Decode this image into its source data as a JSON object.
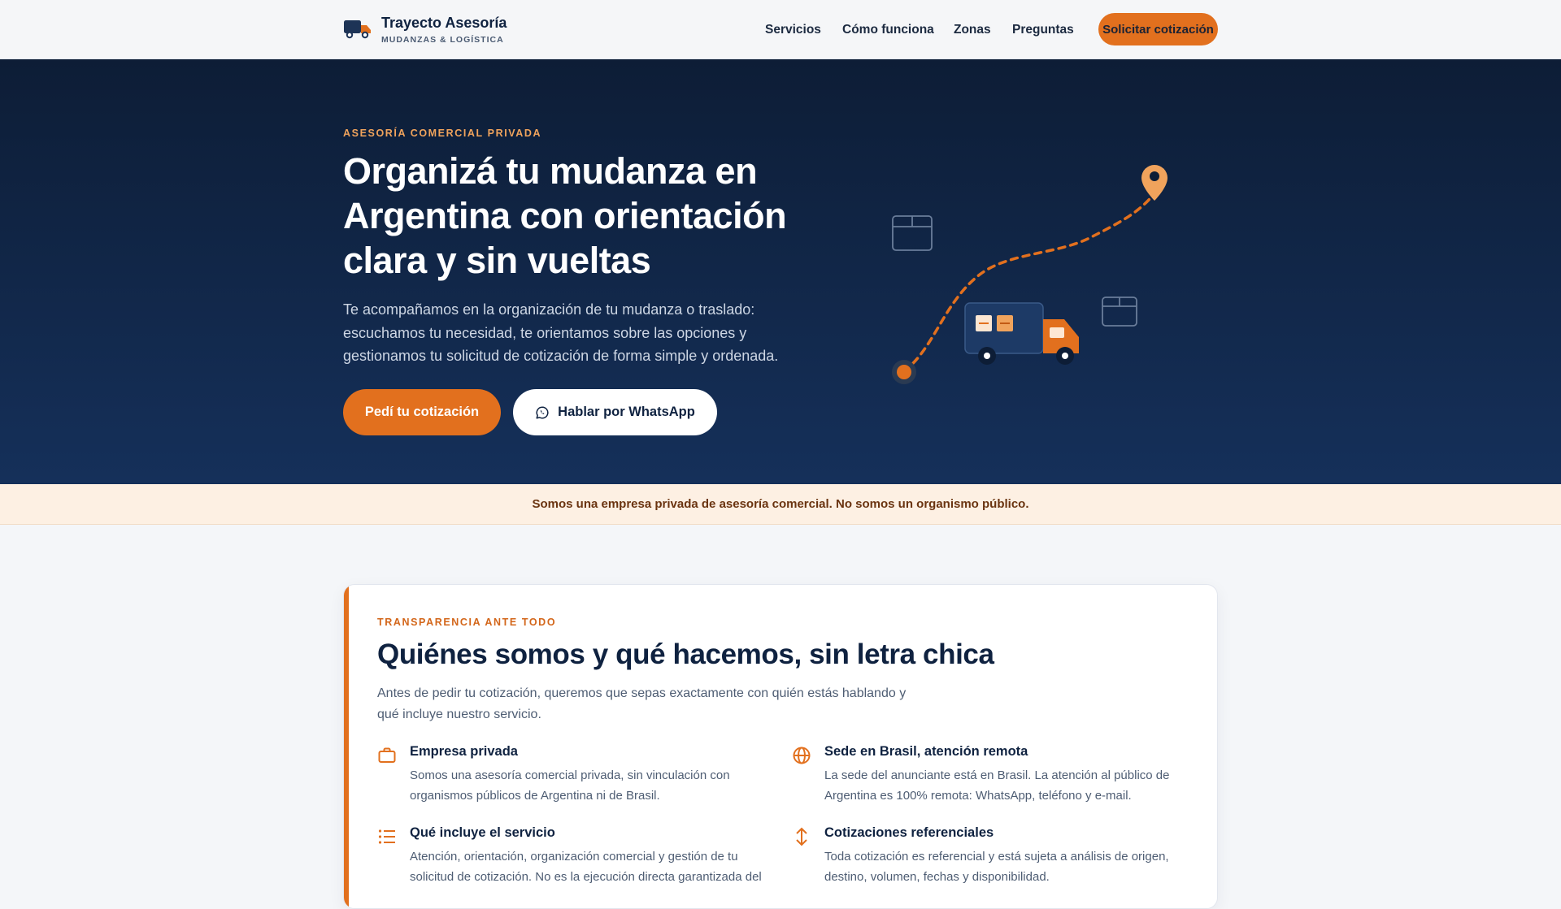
{
  "header": {
    "brand_name": "Trayecto Asesoría",
    "brand_tagline": "MUDANZAS & LOGÍSTICA",
    "nav": [
      {
        "label": "Servicios"
      },
      {
        "label": "Cómo funciona"
      },
      {
        "label": "Zonas"
      },
      {
        "label": "Preguntas"
      }
    ],
    "cta_label": "Solicitar cotización"
  },
  "hero": {
    "eyebrow": "ASESORÍA COMERCIAL PRIVADA",
    "title": "Organizá tu mudanza en Argentina con orientación clara y sin vueltas",
    "lead": "Te acompañamos en la organización de tu mudanza o traslado: escuchamos tu necesidad, te orientamos sobre las opciones y gestionamos tu solicitud de cotización de forma simple y ordenada.",
    "primary_button": "Pedí tu cotización",
    "secondary_button": "Hablar por WhatsApp"
  },
  "notice": "Somos una empresa privada de asesoría comercial. No somos un organismo público.",
  "about": {
    "eyebrow": "TRANSPARENCIA ANTE TODO",
    "title": "Quiénes somos y qué hacemos, sin letra chica",
    "intro": "Antes de pedir tu cotización, queremos que sepas exactamente con quién estás hablando y qué incluye nuestro servicio.",
    "features": [
      {
        "icon": "briefcase-icon",
        "title": "Empresa privada",
        "text": "Somos una asesoría comercial privada, sin vinculación con organismos públicos de Argentina ni de Brasil."
      },
      {
        "icon": "globe-icon",
        "title": "Sede en Brasil, atención remota",
        "text": "La sede del anunciante está en Brasil. La atención al público de Argentina es 100% remota: WhatsApp, teléfono y e-mail."
      },
      {
        "icon": "list-icon",
        "title": "Qué incluye el servicio",
        "text": "Atención, orientación, organización comercial y gestión de tu solicitud de cotización. No es la ejecución directa garantizada del"
      },
      {
        "icon": "arrows-icon",
        "title": "Cotizaciones referenciales",
        "text": "Toda cotización es referencial y está sujeta a análisis de origen, destino, volumen, fechas y disponibilidad."
      }
    ]
  },
  "colors": {
    "accent": "#e2701e",
    "navy": "#0f2240",
    "hero_top": "#0d1d36",
    "hero_bottom": "#15305a",
    "notice_bg": "#fdf0e3"
  }
}
